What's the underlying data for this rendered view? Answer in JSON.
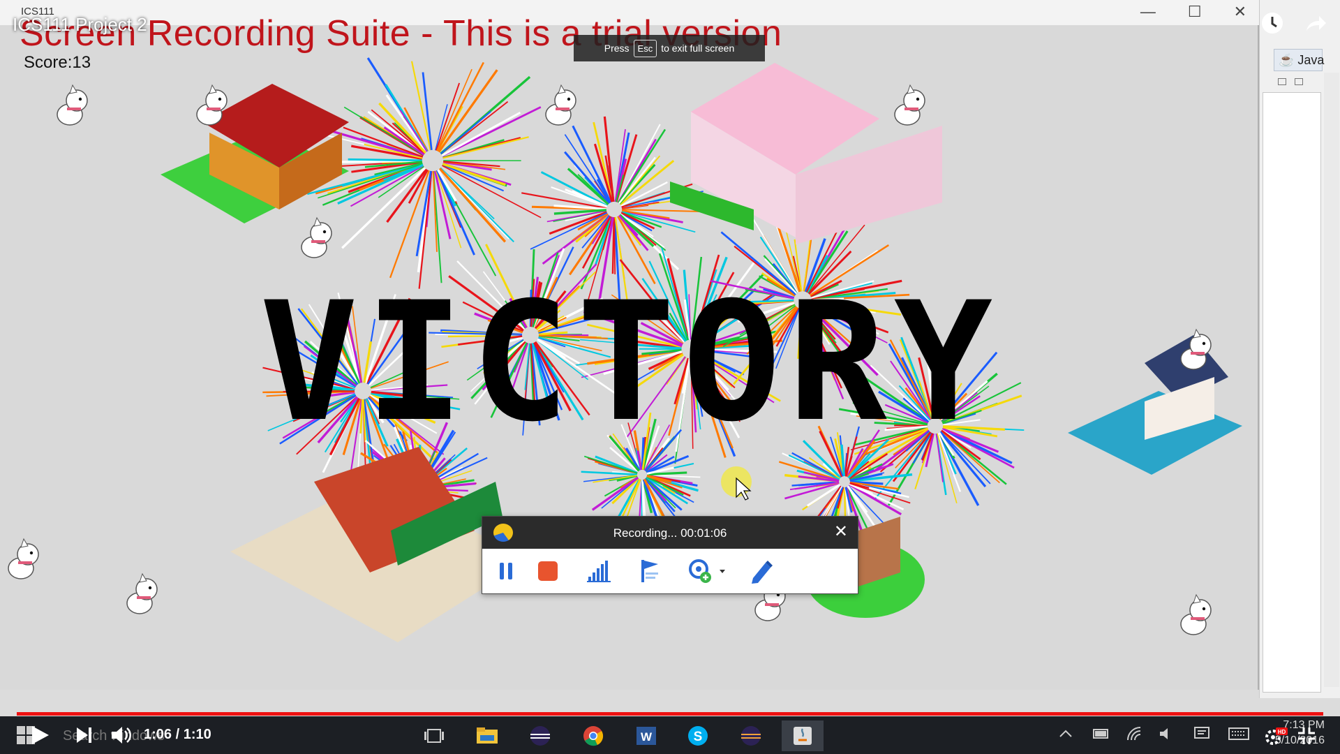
{
  "window": {
    "title": "ICS111",
    "video_title": "ICS111 Project 2"
  },
  "watermark": "Screen Recording Suite - This is a trial version",
  "game": {
    "score_label": "Score:13",
    "banner_text": "VICTORY"
  },
  "fullscreen_toast": {
    "before": "Press",
    "key": "Esc",
    "after": "to exit full screen"
  },
  "recorder": {
    "status": "Recording... 00:01:06",
    "tools": [
      "pause-icon",
      "stop-icon",
      "bar-chart-icon",
      "pin-flag-icon",
      "webcam-add-icon",
      "dropdown-arrow-icon",
      "pencil-icon"
    ],
    "colors": {
      "header": "#2b2b2b",
      "pause": "#2a6bd6",
      "stop": "#e8542e"
    }
  },
  "ide": {
    "perspective_tab": "Java"
  },
  "player": {
    "time": "1:06 / 1:10",
    "progress": 1.0,
    "progress_color": "#ee1111",
    "icons": [
      "play-icon",
      "next-icon",
      "volume-icon",
      "settings-icon",
      "hd-badge-icon",
      "exit-fullscreen-icon",
      "watch-later-icon",
      "share-icon"
    ]
  },
  "taskbar": {
    "search_placeholder": "Search windows",
    "apps": [
      "task-view-icon",
      "file-explorer-icon",
      "eclipse-icon",
      "chrome-icon",
      "word-icon",
      "skype-icon",
      "eclipse-2-icon",
      "java-icon"
    ],
    "tray_icons": [
      "chevron-up-icon",
      "battery-icon",
      "wifi-icon",
      "speaker-icon",
      "notification-icon",
      "keyboard-icon"
    ],
    "clock_time": "7:13 PM",
    "clock_date": "5/10/2016"
  }
}
